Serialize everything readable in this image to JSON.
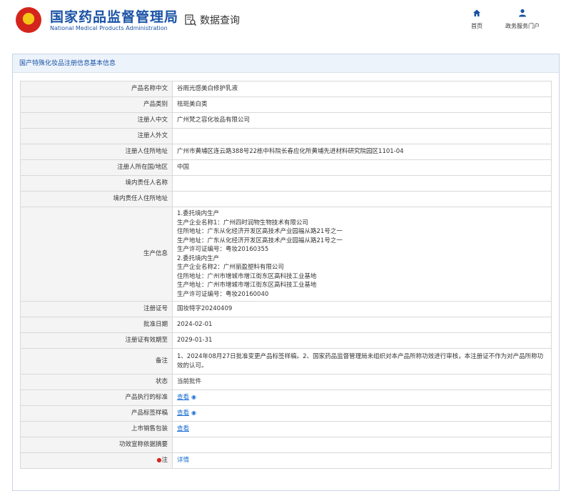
{
  "header": {
    "logo_cn": "国家药品监督管理局",
    "logo_en": "National Medical Products Administration",
    "query_title": "数据查询",
    "nav": [
      {
        "label": "首页",
        "icon": "home-icon"
      },
      {
        "label": "政务服务门户",
        "icon": "user-icon"
      }
    ]
  },
  "panel": {
    "title": "国产特殊化妆品注册信息基本信息"
  },
  "rows": {
    "r1": {
      "label": "产品名称中文",
      "value": "谷雨光感美白修护乳液"
    },
    "r2": {
      "label": "产品类别",
      "value": "祛斑美白类"
    },
    "r3": {
      "label": "注册人中文",
      "value": "广州梵之容化妆品有限公司"
    },
    "r4": {
      "label": "注册人外文",
      "value": ""
    },
    "r5": {
      "label": "注册人住所地址",
      "value": "广州市黄埔区连云路388号22栋中科院长春应化所黄埔先进材料研究院园区1101-04"
    },
    "r6": {
      "label": "注册人所在国/地区",
      "value": "中国"
    },
    "r7": {
      "label": "境内责任人名称",
      "value": ""
    },
    "r8": {
      "label": "境内责任人住所地址",
      "value": ""
    },
    "r9": {
      "label": "生产信息",
      "lines": [
        "1.委托境内生产",
        "生产企业名称1：广州四时润物生物技术有限公司",
        "住所地址：广东从化经济开发区高技术产业园福从路21号之一",
        "生产地址：广东从化经济开发区高技术产业园福从路21号之一",
        "生产许可证编号：粤妆20160355",
        "2.委托境内生产",
        "生产企业名称2：广州丽盈塑料有限公司",
        "住所地址：广州市增城市增江街东区高科技工业基地",
        "生产地址：广州市增城市增江街东区高科技工业基地",
        "生产许可证编号：粤妆20160040"
      ]
    },
    "r10": {
      "label": "注册证号",
      "value": "国妆特字20240409"
    },
    "r11": {
      "label": "批准日期",
      "value": "2024-02-01"
    },
    "r12": {
      "label": "注册证有效期至",
      "value": "2029-01-31"
    },
    "r13": {
      "label": "备注",
      "value": "1、2024年08月27日批准变更产品标签样稿。2、国家药品监督管理局未组织对本产品所称功效进行审核，本注册证不作为对产品所称功效的认可。"
    },
    "r14": {
      "label": "状态",
      "value": "当前批件"
    },
    "r15": {
      "label": "产品执行的标准",
      "value": "查看"
    },
    "r16": {
      "label": "产品标签样稿",
      "value": "查看"
    },
    "r17": {
      "label": "上市销售包装",
      "value": "查看"
    },
    "r18": {
      "label": "功效宣称依据摘要",
      "value": ""
    },
    "r19": {
      "label": "注",
      "value": "详情"
    }
  }
}
